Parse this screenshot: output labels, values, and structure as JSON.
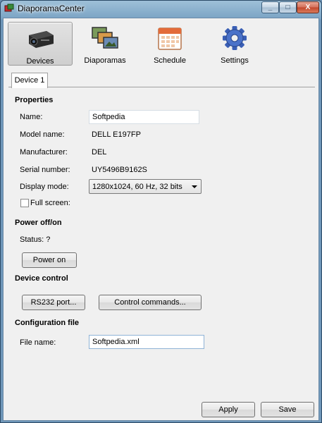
{
  "window": {
    "title": "DiaporamaCenter",
    "minimize": "_",
    "maximize": "□",
    "close": "X"
  },
  "toolbar": [
    {
      "label": "Devices",
      "icon": "projector-icon",
      "active": true
    },
    {
      "label": "Diaporamas",
      "icon": "photos-icon",
      "active": false
    },
    {
      "label": "Schedule",
      "icon": "calendar-icon",
      "active": false
    },
    {
      "label": "Settings",
      "icon": "gear-icon",
      "active": false
    }
  ],
  "tabs": [
    {
      "label": "Device 1"
    }
  ],
  "properties": {
    "heading": "Properties",
    "name_label": "Name:",
    "name_value": "Softpedia",
    "model_label": "Model name:",
    "model_value": "DELL E197FP",
    "manufacturer_label": "Manufacturer:",
    "manufacturer_value": "DEL",
    "serial_label": "Serial number:",
    "serial_value": "UY5496B9162S",
    "display_label": "Display mode:",
    "display_value": "1280x1024, 60 Hz, 32 bits",
    "fullscreen_label": "Full screen:",
    "fullscreen_checked": false
  },
  "power": {
    "heading": "Power off/on",
    "status": "Status: ?",
    "button": "Power on"
  },
  "device_control": {
    "heading": "Device control",
    "rs232_button": "RS232 port...",
    "commands_button": "Control commands..."
  },
  "config": {
    "heading": "Configuration file",
    "file_label": "File name:",
    "file_value": "Softpedia.xml"
  },
  "footer": {
    "apply": "Apply",
    "save": "Save"
  }
}
